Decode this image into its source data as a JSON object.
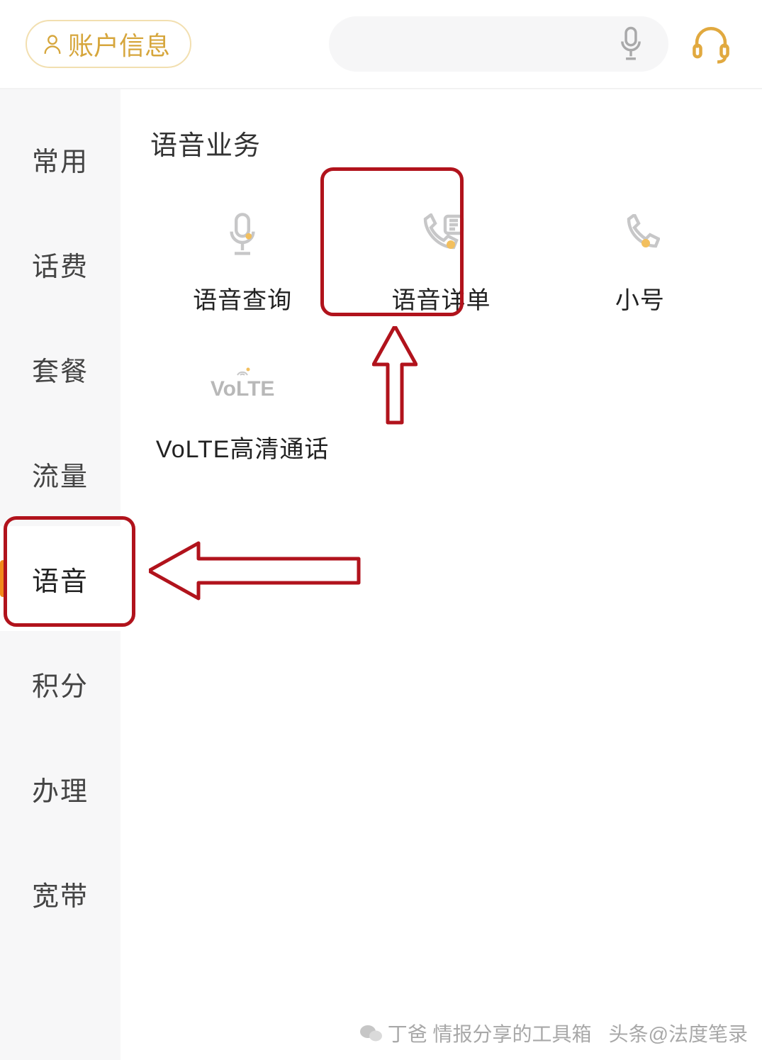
{
  "header": {
    "account_label": "账户信息"
  },
  "sidebar": {
    "items": [
      {
        "label": "常用"
      },
      {
        "label": "话费"
      },
      {
        "label": "套餐"
      },
      {
        "label": "流量"
      },
      {
        "label": "语音"
      },
      {
        "label": "积分"
      },
      {
        "label": "办理"
      },
      {
        "label": "宽带"
      }
    ],
    "active_index": 4
  },
  "content": {
    "section_title": "语音业务",
    "tiles": [
      {
        "label": "语音查询",
        "icon": "mic"
      },
      {
        "label": "语音详单",
        "icon": "call-list"
      },
      {
        "label": "小号",
        "icon": "phone"
      },
      {
        "label": "VoLTE高清通话",
        "icon": "volte"
      }
    ]
  },
  "watermark": {
    "wechat": "丁爸 情报分享的工具箱",
    "toutiao": "头条@法度笔录"
  },
  "colors": {
    "accent": "#d6a63c",
    "highlight": "#b1131c",
    "orange": "#f28a1a"
  }
}
